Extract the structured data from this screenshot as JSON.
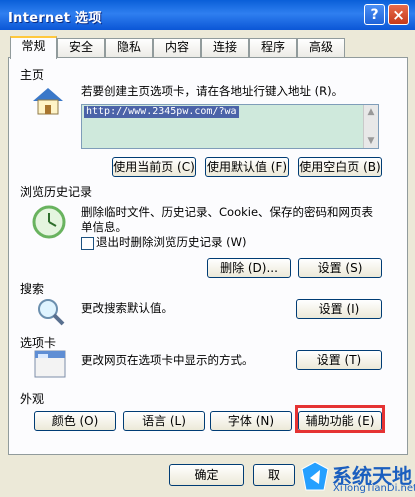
{
  "title": "Internet 选项",
  "title_buttons": {
    "help": "?",
    "close": "×"
  },
  "tabs": [
    "常规",
    "安全",
    "隐私",
    "内容",
    "连接",
    "程序",
    "高级"
  ],
  "home": {
    "heading": "主页",
    "description": "若要创建主页选项卡，请在各地址行键入地址 (R)。",
    "url": "http://www.2345pw.com/?wa",
    "buttons": [
      "使用当前页 (C)",
      "使用默认值 (F)",
      "使用空白页 (B)"
    ]
  },
  "history": {
    "heading": "浏览历史记录",
    "description": "删除临时文件、历史记录、Cookie、保存的密码和网页表单信息。",
    "checkbox_label": "退出时删除浏览历史记录 (W)",
    "delete_button": "删除 (D)...",
    "settings_button": "设置 (S)"
  },
  "search": {
    "heading": "搜索",
    "description": "更改搜索默认值。",
    "settings_button": "设置 (I)"
  },
  "tabs_section": {
    "heading": "选项卡",
    "description": "更改网页在选项卡中显示的方式。",
    "settings_button": "设置 (T)"
  },
  "appearance": {
    "heading": "外观",
    "buttons": [
      "颜色 (O)",
      "语言 (L)",
      "字体 (N)",
      "辅助功能 (E)"
    ]
  },
  "footer": {
    "ok": "确定",
    "cancel": "取"
  },
  "watermark": {
    "name": "系统天地",
    "url": "XiTongTianDi.net"
  }
}
